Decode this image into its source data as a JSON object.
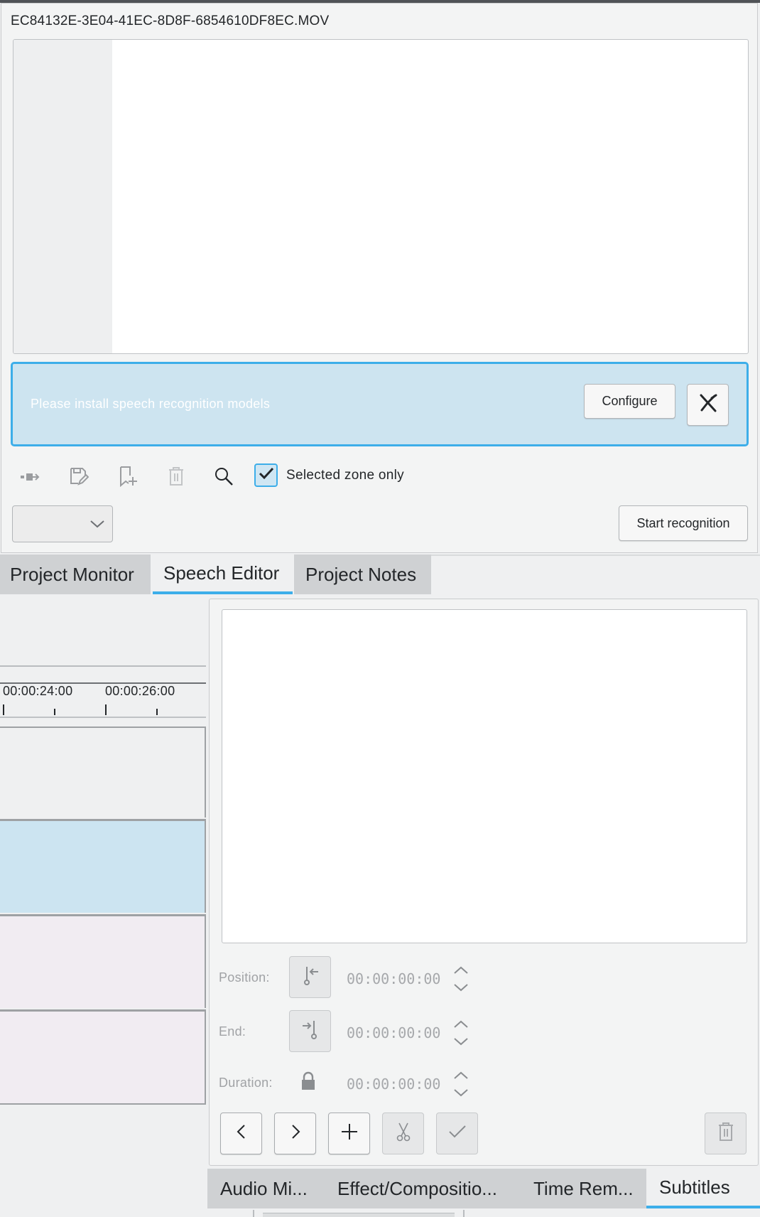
{
  "speech_editor": {
    "clip_name": "EC84132E-3E04-41EC-8D8F-6854610DF8EC.MOV",
    "banner_message": "Please install speech recognition models",
    "configure_label": "Configure",
    "selected_zone_label": "Selected zone only",
    "selected_zone_checked": true,
    "language_value": "",
    "start_recognition_label": "Start recognition",
    "toolbar_icons": [
      "insert-zone-icon",
      "save-edit-icon",
      "add-bookmark-icon",
      "delete-icon",
      "search-icon"
    ]
  },
  "dock_tabs": [
    {
      "label": "Project Monitor",
      "active": false
    },
    {
      "label": "Speech Editor",
      "active": true
    },
    {
      "label": "Project Notes",
      "active": false
    }
  ],
  "timeline": {
    "timecodes": [
      "00:00:24:00",
      "00:00:26:00"
    ]
  },
  "subtitles": {
    "position_label": "Position:",
    "position_value": "00:00:00:00",
    "end_label": "End:",
    "end_value": "00:00:00:00",
    "duration_label": "Duration:",
    "duration_value": "00:00:00:00"
  },
  "bottom_tabs": [
    {
      "label": "Audio Mi...",
      "active": false
    },
    {
      "label": "Effect/Compositio...",
      "active": false
    },
    {
      "label": "Time Rem...",
      "active": false
    },
    {
      "label": "Subtitles",
      "active": true
    }
  ],
  "colors": {
    "accent": "#3daee9",
    "banner_bg": "#cde4f0",
    "selected_track": "#cce4f1",
    "audio_track": "#f1ecf2"
  }
}
